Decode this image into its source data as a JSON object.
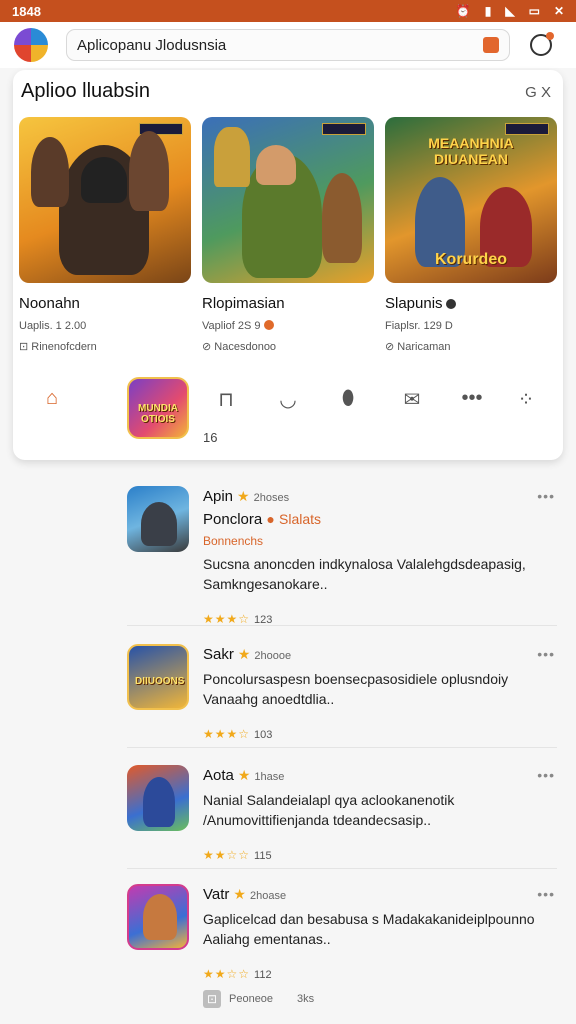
{
  "status": {
    "time": "1848",
    "icons": [
      "alarm-icon",
      "signal-icon",
      "wifi-icon",
      "battery-icon",
      "close-icon"
    ]
  },
  "topbar": {
    "search_value": "Aplicopanu Jlodusnsia"
  },
  "card": {
    "title": "Aplioo lluabsin",
    "close_label": "G X",
    "featured": [
      {
        "name": "Noonahn",
        "meta": "Uaplis. 1 2.00",
        "sub": "Rinenofcdern"
      },
      {
        "name": "Rlopimasian",
        "meta": "Vapliof 2S 9",
        "sub": "Nacesdonoo"
      },
      {
        "name": "Slapunis",
        "meta": "Fiaplsr. 129 D",
        "sub": "Naricaman"
      }
    ],
    "thumb_text_3": "Korurdeo",
    "quick_count": "16"
  },
  "list": [
    {
      "name": "Apin",
      "small": "2hoses",
      "line2": "Ponclora",
      "tag": "Slalats",
      "line3": "Bonnenchs",
      "desc": "Sucsna anoncden indkynalosa Valalehgdsdeapasig, Samkngesanokare..",
      "rating_count": "123",
      "stars": "★★★☆"
    },
    {
      "name": "Sakr",
      "small": "2hoooe",
      "line2": "",
      "tag": "",
      "line3": "",
      "desc": "Poncolursaspesn boensecpasosidiele oplusndoiy Vanaahg anoedtdlia..",
      "rating_count": "103",
      "stars": "★★★☆"
    },
    {
      "name": "Aota",
      "small": "1hase",
      "line2": "",
      "tag": "",
      "line3": "",
      "desc": "Nanial Salandeialapl qya aclookanenotik /Anumovittifienjanda tdeandecsasip..",
      "rating_count": "115",
      "stars": "★★☆☆"
    },
    {
      "name": "Vatr",
      "small": "2hoase",
      "line2": "",
      "tag": "",
      "line3": "",
      "desc": "Gaplicelcad dan besabusa s Madakakanideiplpounno Aaliahg ementanas..",
      "rating_count": "112",
      "stars": "★★☆☆"
    }
  ],
  "footer": {
    "label": "Peoneoe",
    "count": "3ks"
  },
  "colors": {
    "accent": "#d8652a",
    "statusbar": "#c5501e",
    "star": "#f1a91b"
  }
}
